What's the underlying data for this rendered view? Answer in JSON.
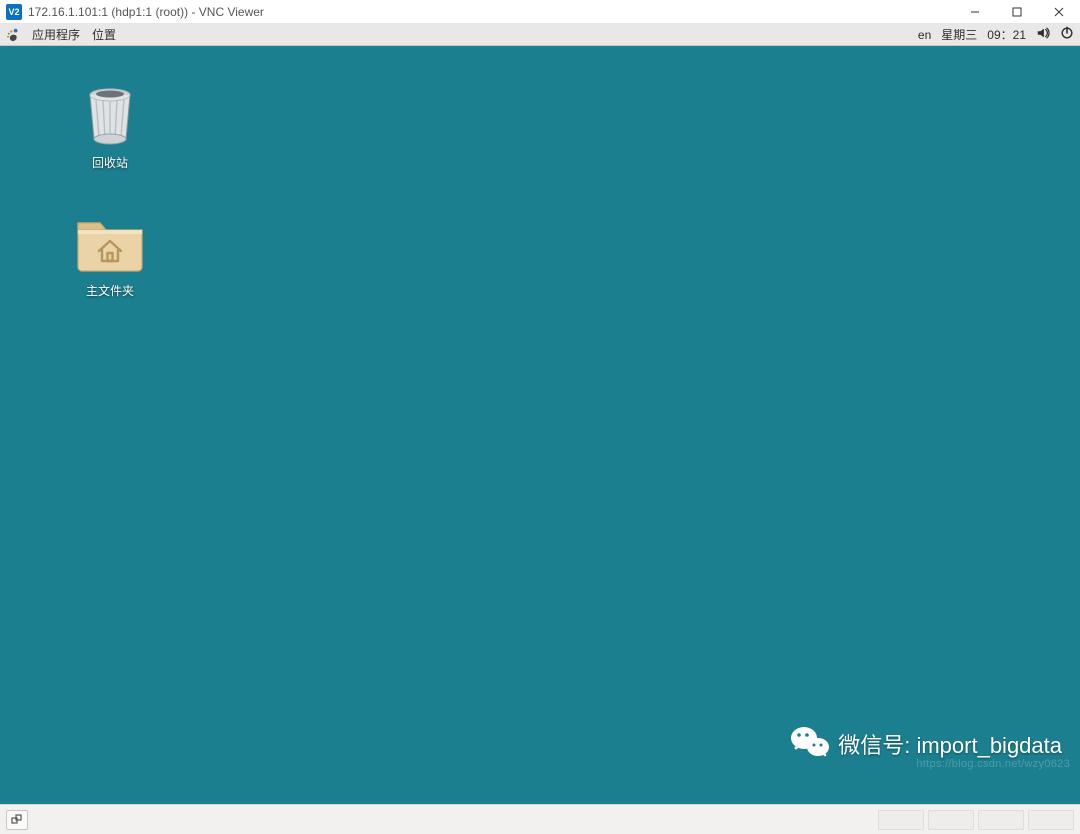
{
  "window": {
    "app_icon_label": "V2",
    "title": "172.16.1.101:1 (hdp1:1 (root)) - VNC Viewer"
  },
  "gnome_panel": {
    "menu_applications": "应用程序",
    "menu_places": "位置",
    "lang": "en",
    "day": "星期三",
    "time": "09：21"
  },
  "desktop": {
    "trash_label": "回收站",
    "home_label": "主文件夹"
  },
  "watermark": {
    "text": "微信号: import_bigdata",
    "csdn": "https://blog.csdn.net/wzy0623"
  }
}
